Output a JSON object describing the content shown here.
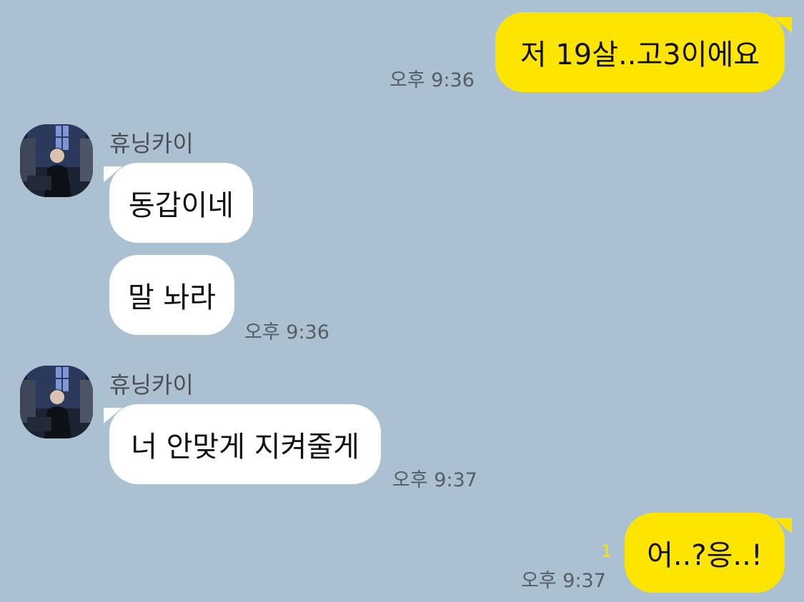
{
  "messages": [
    {
      "side": "right",
      "text": "저 19살..고3이에요",
      "time": "오후 9:36"
    },
    {
      "side": "left",
      "sender": "휴닝카이",
      "text": "동갑이네"
    },
    {
      "side": "left",
      "text": "말 놔라",
      "time": "오후 9:36"
    },
    {
      "side": "left",
      "sender": "휴닝카이",
      "text": "너 안맞게 지켜줄게",
      "time": "오후 9:37"
    },
    {
      "side": "right",
      "text": "어..?응..!",
      "time": "오후 9:37",
      "unread": "1"
    }
  ],
  "colors": {
    "background": "#abc1d1",
    "my_bubble": "#fee500",
    "other_bubble": "#ffffff",
    "time_text": "#555d66",
    "unread": "#fee500"
  },
  "icons": {
    "avatar": "profile-photo-avatar"
  }
}
